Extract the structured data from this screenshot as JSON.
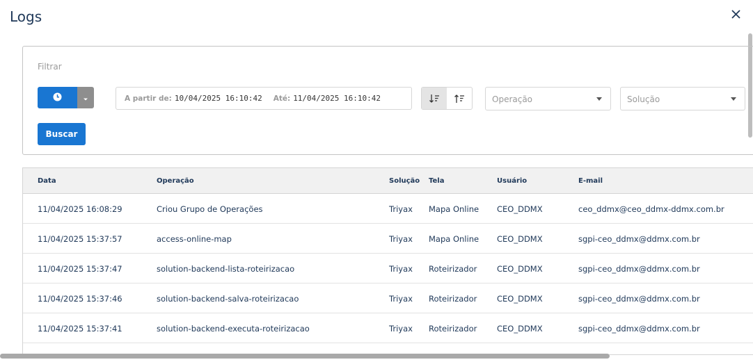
{
  "dialog": {
    "title": "Logs",
    "close_icon": "close-icon"
  },
  "filter": {
    "label": "Filtrar",
    "clock_icon": "clock-icon",
    "dropdown_icon": "caret-down-icon",
    "from_label": "A partir de",
    "from_value": "10/04/2025 16:10:42",
    "to_label": "Até",
    "to_value": "11/04/2025 16:10:42",
    "sort_desc_icon": "sort-descending-icon",
    "sort_asc_icon": "sort-ascending-icon",
    "operation_placeholder": "Operação",
    "solution_placeholder": "Solução",
    "search_label": "Buscar",
    "accent_color": "#1976d2"
  },
  "table": {
    "columns": [
      "Data",
      "Operação",
      "Solução",
      "Tela",
      "Usuário",
      "E-mail"
    ],
    "rows": [
      {
        "data": "11/04/2025 16:08:29",
        "operacao": "Criou Grupo de Operações",
        "solucao": "Triyax",
        "tela": "Mapa Online",
        "usuario": "CEO_DDMX",
        "email": "ceo_ddmx@ceo_ddmx-ddmx.com.br"
      },
      {
        "data": "11/04/2025 15:37:57",
        "operacao": "access-online-map",
        "solucao": "Triyax",
        "tela": "Mapa Online",
        "usuario": "CEO_DDMX",
        "email": "sgpi-ceo_ddmx@ddmx.com.br"
      },
      {
        "data": "11/04/2025 15:37:47",
        "operacao": "solution-backend-lista-roteirizacao",
        "solucao": "Triyax",
        "tela": "Roteirizador",
        "usuario": "CEO_DDMX",
        "email": "sgpi-ceo_ddmx@ddmx.com.br"
      },
      {
        "data": "11/04/2025 15:37:46",
        "operacao": "solution-backend-salva-roteirizacao",
        "solucao": "Triyax",
        "tela": "Roteirizador",
        "usuario": "CEO_DDMX",
        "email": "sgpi-ceo_ddmx@ddmx.com.br"
      },
      {
        "data": "11/04/2025 15:37:41",
        "operacao": "solution-backend-executa-roteirizacao",
        "solucao": "Triyax",
        "tela": "Roteirizador",
        "usuario": "CEO_DDMX",
        "email": "sgpi-ceo_ddmx@ddmx.com.br"
      }
    ]
  }
}
